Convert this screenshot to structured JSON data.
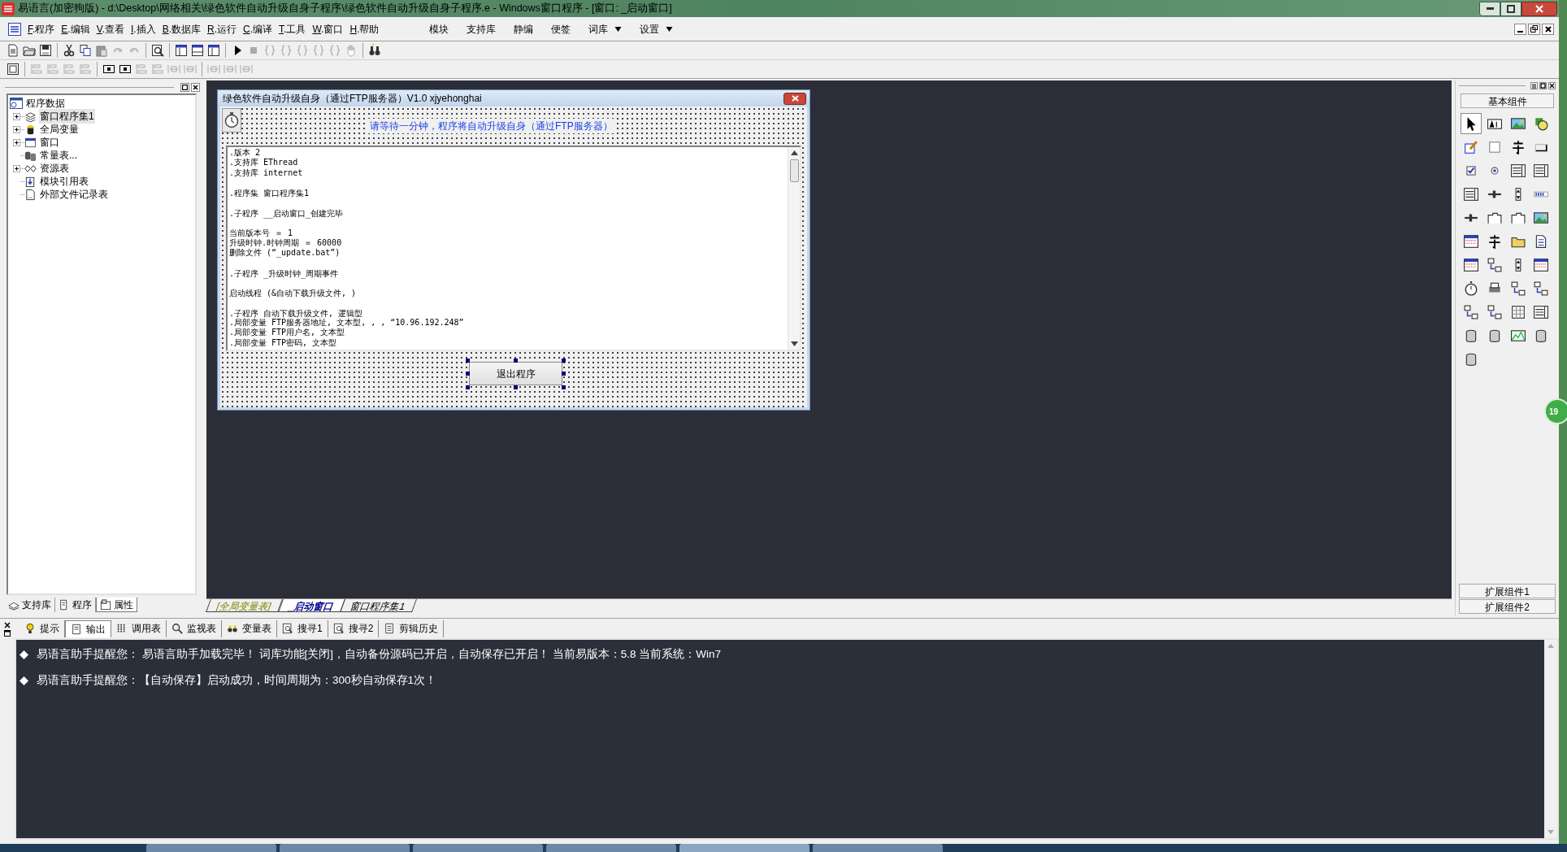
{
  "window": {
    "title": "易语言(加密狗版) - d:\\Desktop\\网络相关\\绿色软件自动升级自身子程序\\绿色软件自动升级自身子程序.e - Windows窗口程序 - [窗口: _启动窗口]"
  },
  "menu": [
    {
      "label": "F.程序"
    },
    {
      "label": "E.编辑"
    },
    {
      "label": "V.查看"
    },
    {
      "label": "I.插入"
    },
    {
      "label": "B.数据库"
    },
    {
      "label": "R.运行"
    },
    {
      "label": "C.编译"
    },
    {
      "label": "T.工具"
    },
    {
      "label": "W.窗口"
    },
    {
      "label": "H.帮助"
    }
  ],
  "menu_right": [
    {
      "label": "模块",
      "dropdown": false
    },
    {
      "label": "支持库",
      "dropdown": false
    },
    {
      "label": "静编",
      "dropdown": false
    },
    {
      "label": "便签",
      "dropdown": false
    },
    {
      "label": "词库",
      "dropdown": true
    },
    {
      "label": "设置",
      "dropdown": true
    }
  ],
  "project_tree": {
    "root": "程序数据",
    "items": [
      {
        "label": "窗口程序集1",
        "expandable": true,
        "selected": true
      },
      {
        "label": "全局变量",
        "expandable": true,
        "selected": false
      },
      {
        "label": "窗口",
        "expandable": true,
        "selected": false
      },
      {
        "label": "常量表...",
        "expandable": false,
        "selected": false
      },
      {
        "label": "资源表",
        "expandable": true,
        "selected": false
      },
      {
        "label": "模块引用表",
        "expandable": false,
        "selected": false
      },
      {
        "label": "外部文件记录表",
        "expandable": false,
        "selected": false
      }
    ]
  },
  "left_tabs": [
    {
      "label": "支持库",
      "selected": false
    },
    {
      "label": "程序",
      "selected": false
    },
    {
      "label": "属性",
      "selected": true
    }
  ],
  "dialog": {
    "title": "绿色软件自动升级自身（通过FTP服务器）V1.0 xjyehonghai",
    "message": "请等待一分钟，程序将自动升级自身（通过FTP服务器）",
    "code_lines": [
      {
        "text": ".版本 2",
        "gap_before": false
      },
      {
        "text": ".支持库 EThread",
        "gap_before": false
      },
      {
        "text": ".支持库 internet",
        "gap_before": false
      },
      {
        "text": ".程序集 窗口程序集1",
        "gap_before": true
      },
      {
        "text": ".子程序 __启动窗口_创建完毕",
        "gap_before": true
      },
      {
        "text": "当前版本号 ＝ 1",
        "gap_before": true
      },
      {
        "text": "升级时钟.时钟周期 ＝ 60000",
        "gap_before": false
      },
      {
        "text": "删除文件 (“_update.bat”)",
        "gap_before": false
      },
      {
        "text": ".子程序 _升级时钟_周期事件",
        "gap_before": true
      },
      {
        "text": "启动线程 (&自动下载升级文件, )",
        "gap_before": true
      },
      {
        "text": ".子程序 自动下载升级文件, 逻辑型",
        "gap_before": true
      },
      {
        "text": ".局部变量 FTP服务器地址, 文本型, , , “10.96.192.248”",
        "gap_before": false
      },
      {
        "text": ".局部变量 FTP用户名, 文本型",
        "gap_before": false
      },
      {
        "text": ".局部变量 FTP密码, 文本型",
        "gap_before": false
      }
    ],
    "button": "退出程序"
  },
  "toolbox": {
    "header": "基本组件",
    "footer": [
      "扩展组件1",
      "扩展组件2"
    ]
  },
  "editor_tabs": [
    {
      "label": "[全局变量表]",
      "selected": false
    },
    {
      "label": "_启动窗口",
      "selected": true
    },
    {
      "label": "窗口程序集1",
      "selected": false
    }
  ],
  "output_tabs": [
    {
      "label": "提示",
      "selected": false
    },
    {
      "label": "输出",
      "selected": true
    },
    {
      "label": "调用表",
      "selected": false
    },
    {
      "label": "监视表",
      "selected": false
    },
    {
      "label": "变量表",
      "selected": false
    },
    {
      "label": "搜寻1",
      "selected": false
    },
    {
      "label": "搜寻2",
      "selected": false
    },
    {
      "label": "剪辑历史",
      "selected": false
    }
  ],
  "output_lines": [
    "易语言助手提醒您：  易语言助手加载完毕！ 词库功能[关闭]，自动备份源码已开启，自动保存已开启！ 当前易版本：5.8  当前系统：Win7",
    "易语言助手提醒您：【自动保存】启动成功，时间周期为：300秒自动保存1次！"
  ],
  "desktop_badge": "19"
}
